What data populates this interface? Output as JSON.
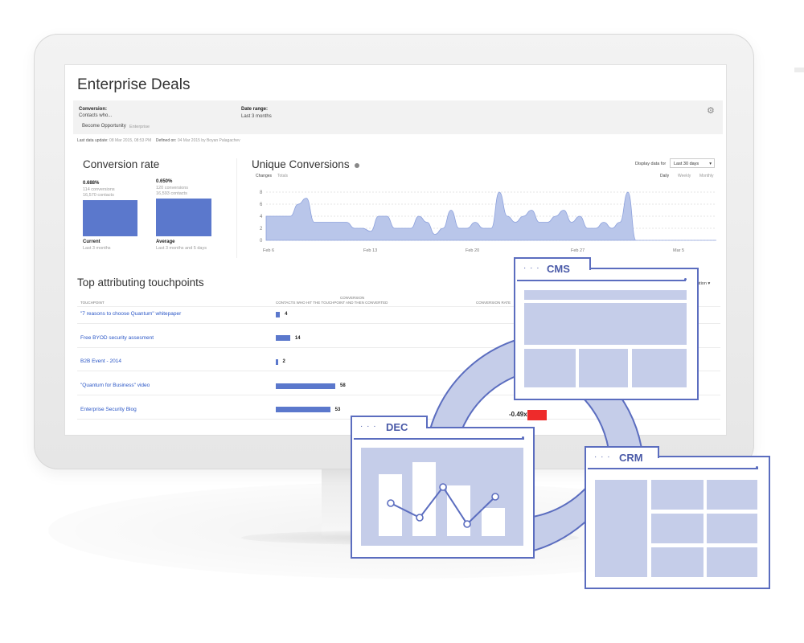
{
  "dashboard": {
    "title": "Enterprise Deals",
    "filters": {
      "conversion_label": "Conversion:",
      "conversion_value": "Contacts who...",
      "conversion_event": "Become Opportunity",
      "conversion_segment": "Enterprise",
      "date_range_label": "Date range:",
      "date_range_value": "Last 3 months"
    },
    "meta": {
      "last_update_label": "Last data update:",
      "last_update_value": "08 Mar 2015, 08:53 PM",
      "defined_label": "Defined on:",
      "defined_value": "04 Mar 2015 by Boyan Palagachev"
    },
    "conversion_rate": {
      "title": "Conversion rate",
      "current": {
        "pct": "0.688%",
        "conversions": "114 conversions",
        "contacts": "16,570 contacts",
        "label": "Current",
        "sublabel": "Last 3 months"
      },
      "average": {
        "pct": "0.650%",
        "conversions": "120 conversions",
        "contacts": "16,593 contacts",
        "label": "Average",
        "sublabel": "Last 3 months and 5 days"
      }
    },
    "unique_conversions": {
      "title": "Unique Conversions",
      "info_icon": "info-icon",
      "tabs": [
        "Changes",
        "Totals"
      ],
      "display_label": "Display data for",
      "display_value": "Last 30 days",
      "periods": [
        "Daily",
        "Weekly",
        "Monthly"
      ]
    },
    "touchpoints": {
      "title": "Top attributing touchpoints",
      "col_touchpoint": "TOUCHPOINT",
      "col_conversion": "CONVERSION",
      "col_conversion_sub": "CONTACTS WHO HIT THE TOUCHPOINT AND THEN CONVERTED",
      "col_rate": "CONVERSION RATE",
      "col_attribution_fragment": "ution",
      "rows": [
        {
          "name": "\"7 reasons to choose Quantum\" whitepaper",
          "value": 4
        },
        {
          "name": "Free BYOD security assesment",
          "value": 14
        },
        {
          "name": "B2B Event - 2014",
          "value": 2
        },
        {
          "name": "\"Quantum for Business\" video",
          "value": 58
        },
        {
          "name": "Enterprise Security Blog",
          "value": 53
        }
      ],
      "rate_value": "-0.49x"
    }
  },
  "chart_data": [
    {
      "type": "bar",
      "categories": [
        "Current",
        "Average"
      ],
      "values": [
        0.688,
        0.65
      ],
      "title": "Conversion rate"
    },
    {
      "type": "area",
      "title": "Unique Conversions",
      "x_ticks": [
        "Feb 6",
        "Feb 13",
        "Feb 20",
        "Feb 27",
        "Mar 5"
      ],
      "y_ticks": [
        0,
        2,
        4,
        6,
        8
      ],
      "ylim": [
        0,
        8
      ],
      "values": [
        4,
        4,
        4,
        4,
        6,
        7,
        3,
        3,
        3,
        3,
        3,
        2,
        2,
        1.5,
        4,
        4,
        2,
        2,
        2,
        4,
        3,
        1,
        2,
        5,
        2,
        2,
        3,
        2,
        2,
        8,
        4,
        3,
        4,
        5,
        3,
        3,
        4,
        5,
        3,
        4,
        2,
        2,
        3,
        2,
        3,
        8,
        0,
        0,
        0,
        0,
        0,
        0,
        0,
        0,
        0,
        0,
        0
      ]
    }
  ],
  "overlay": {
    "cms": {
      "title": "CMS",
      "dots": "· · ·"
    },
    "dec": {
      "title": "DEC",
      "dots": "· · ·"
    },
    "crm": {
      "title": "CRM",
      "dots": "· · ·"
    }
  },
  "colors": {
    "accent": "#5b78cc",
    "panel_border": "#5b6dbf",
    "panel_fill": "#c5cde9",
    "ring": "#c5cde9",
    "alert": "#ee2b2b"
  }
}
